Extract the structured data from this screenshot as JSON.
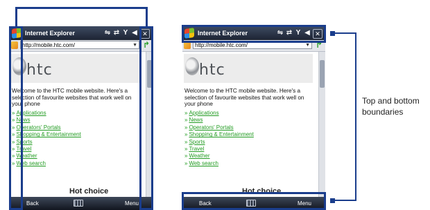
{
  "browser": {
    "title": "Internet Explorer",
    "url": "http://mobile.htc.com/",
    "logo_text": "htc",
    "intro_text": "Welcome to the HTC mobile website. Here's a selection of favourite websites that work well on your phone",
    "links": [
      "Applications",
      "News",
      "Operators' Portals",
      "Shopping & Entertainment",
      "Sports",
      "Travel",
      "Weather",
      "Web search"
    ],
    "hot_choice": "Hot choice",
    "softkey_left": "Back",
    "softkey_right": "Menu",
    "icons": [
      "windows-logo-icon",
      "connection-icon",
      "sync-icon",
      "signal-icon",
      "volume-icon",
      "close-icon",
      "page-icon",
      "go-arrow-icon",
      "keyboard-icon"
    ]
  },
  "annotation": {
    "label": "Top and bottom boundaries",
    "highlight_color": "#1a3d8c"
  }
}
